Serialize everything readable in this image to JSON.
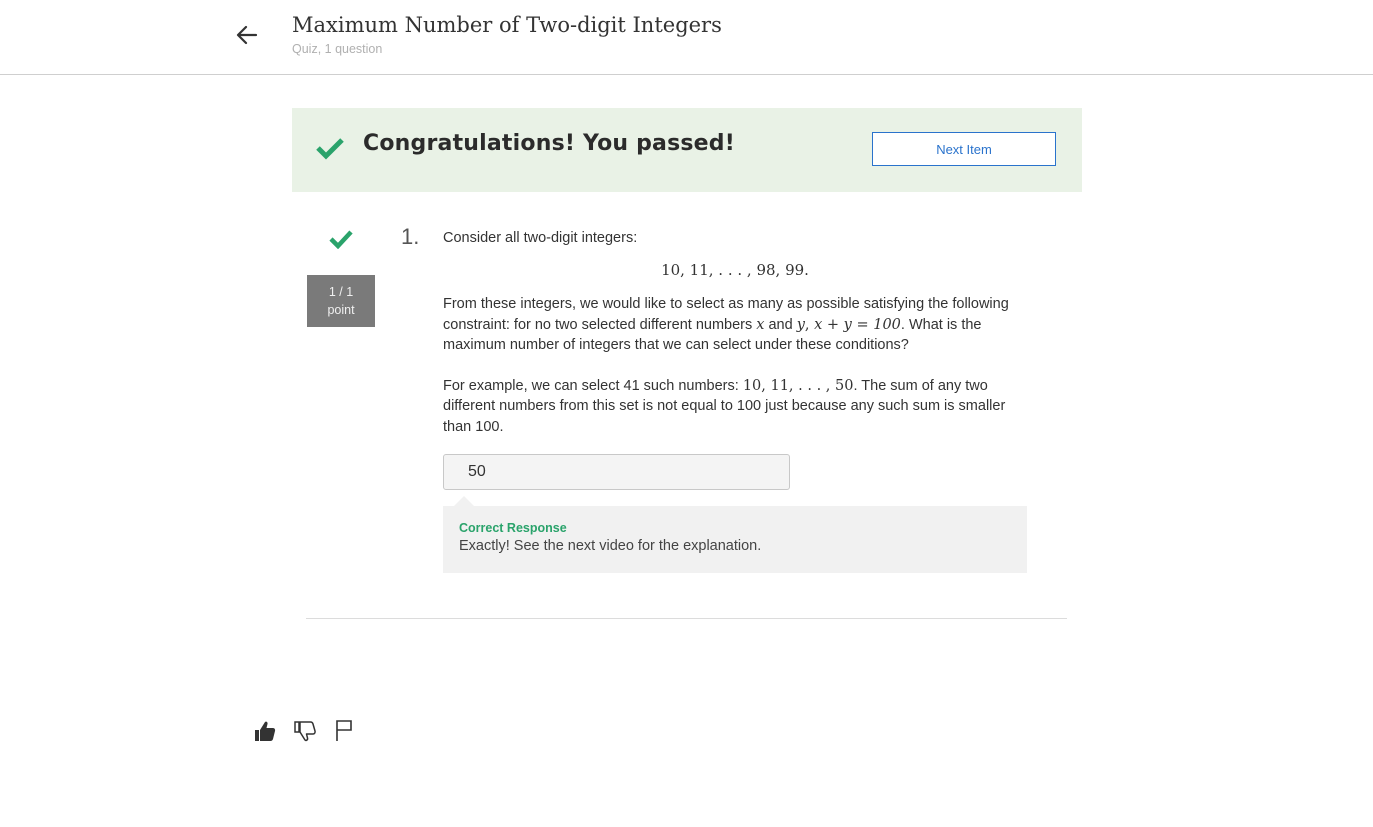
{
  "header": {
    "title": "Maximum Number of Two-digit Integers",
    "subtitle": "Quiz, 1 question",
    "back_icon": "arrow-left-icon"
  },
  "banner": {
    "message": "Congratulations! You passed!",
    "next_label": "Next Item",
    "check_icon": "check-icon",
    "accent_color": "#2aa36b",
    "background_color": "#e9f2e6"
  },
  "question": {
    "number": "1.",
    "points_line1": "1 / 1",
    "points_line2": "point",
    "intro": "Consider all two-digit integers:",
    "sequence": "10, 11, . . . , 98, 99.",
    "p1_text1": "From these integers, we would like to select as many as possible satisfying the following constraint: for no two selected different numbers ",
    "p1_x": "x",
    "p1_and": " and ",
    "p1_y": "y",
    "p1_comma": ", ",
    "p1_eq": "x + y = 100",
    "p1_text2": ". What is the maximum number of integers that we can select under these conditions?",
    "p2_text1": "For example, we can select 41 such numbers: ",
    "p2_math": "10, 11, . . . , 50",
    "p2_text2": ". The sum of any two different numbers from this set is not equal to 100 just because any such sum is smaller than 100.",
    "answer_value": "50"
  },
  "feedback": {
    "label": "Correct Response",
    "text": "Exactly! See the next video for the explanation."
  },
  "actions": {
    "like_icon": "thumbs-up-icon",
    "dislike_icon": "thumbs-down-icon",
    "flag_icon": "flag-icon"
  }
}
